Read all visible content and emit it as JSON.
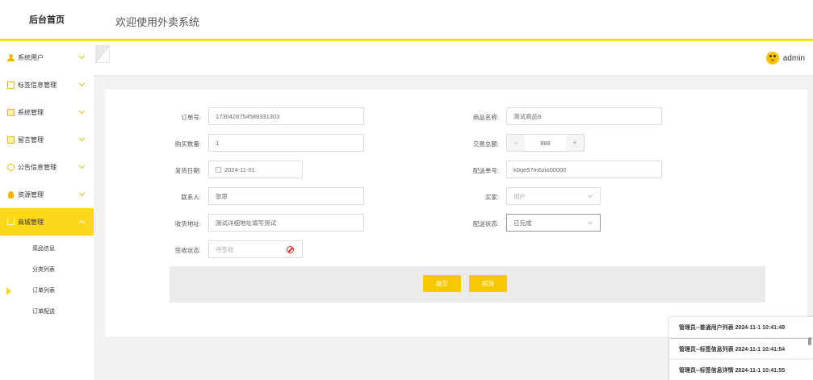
{
  "header": {
    "logo_text": "后台首页",
    "welcome": "欢迎使用外卖系统"
  },
  "colors": {
    "accent": "#f5d922",
    "active_menu_bg": "#fbd81c",
    "button": "#f5c800"
  },
  "sidebar": {
    "items": [
      {
        "label": "系统用户",
        "icon": "user-icon"
      },
      {
        "label": "标签信息管理",
        "icon": "tag-icon"
      },
      {
        "label": "系统管理",
        "icon": "settings-icon"
      },
      {
        "label": "留言管理",
        "icon": "message-icon"
      },
      {
        "label": "公告信息管理",
        "icon": "notice-icon"
      },
      {
        "label": "资源管理",
        "icon": "bulb-icon"
      },
      {
        "label": "商城管理",
        "icon": "cart-icon"
      }
    ],
    "submenu": [
      "菜品信息",
      "分类列表",
      "订单列表",
      "订单配送"
    ]
  },
  "user": {
    "name": "admin"
  },
  "form": {
    "order_no": {
      "label": "订单号:",
      "value": "1730428754589331303"
    },
    "product_name": {
      "label": "商品名称:",
      "value": "测试商品9"
    },
    "quantity": {
      "label": "购买数量:",
      "value": "1"
    },
    "total": {
      "label": "交易总额:",
      "value": "888",
      "minus": "−",
      "plus": "+"
    },
    "ship_date": {
      "label": "发货日期:",
      "value": "2024-11-01"
    },
    "delivery_no": {
      "label": "配送单号:",
      "value": "k0qe57m6zio00000"
    },
    "contact": {
      "label": "联系人:",
      "value": "张思"
    },
    "buyer": {
      "label": "买家:",
      "value": "用户"
    },
    "address": {
      "label": "收货地址:",
      "value": "测试详细地址填写测试"
    },
    "delivery_status": {
      "label": "配送状态:",
      "value": "已完成"
    },
    "sign_status": {
      "label": "签收状态:",
      "value": "待签收"
    }
  },
  "buttons": {
    "submit": "提交",
    "cancel": "取消"
  },
  "notifications": [
    "管理员--普通用户列表 2024-11-1 10:41:49",
    "管理员--标签信息列表 2024-11-1 10:41:54",
    "管理员--标签信息详情 2024-11-1 10:41:55"
  ]
}
